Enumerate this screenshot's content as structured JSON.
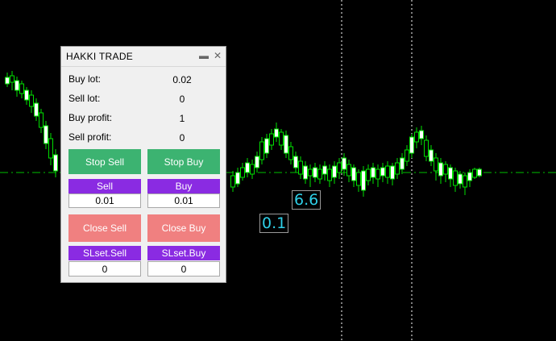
{
  "panel": {
    "title": "HAKKI TRADE",
    "rows": [
      {
        "label": "Buy lot:",
        "value": "0.02"
      },
      {
        "label": "Sell lot:",
        "value": "0"
      },
      {
        "label": "Buy profit:",
        "value": "1"
      },
      {
        "label": "Sell profit:",
        "value": "0"
      }
    ],
    "stop_sell_label": "Stop Sell",
    "stop_buy_label": "Stop Buy",
    "sell_label": "Sell",
    "buy_label": "Buy",
    "sell_lot_input": "0.01",
    "buy_lot_input": "0.01",
    "close_sell_label": "Close Sell",
    "close_buy_label": "Close Buy",
    "slset_sell_label": "SLset.Sell",
    "slset_buy_label": "SLset.Buy",
    "slset_sell_input": "0",
    "slset_buy_input": "0"
  },
  "chart_labels": {
    "upper": "6.6",
    "lower": "0.1"
  },
  "colors": {
    "candle": "#00e000",
    "bullish_body": "#000000",
    "bearish_body": "#ffffff",
    "price_line": "#00c000",
    "stop_button": "#3cb371",
    "close_button": "#f08080",
    "trade_button": "#8a2be2",
    "label_text": "#2fd0e8"
  }
}
